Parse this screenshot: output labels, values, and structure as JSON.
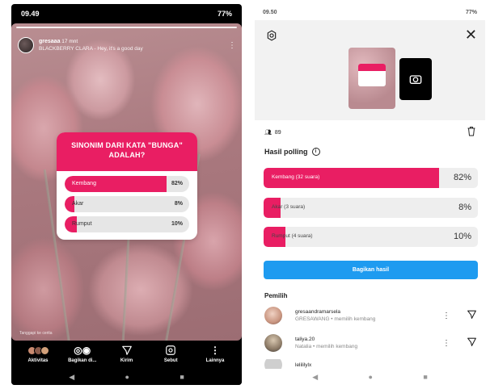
{
  "left": {
    "status": {
      "time": "09.49",
      "battery": "77%"
    },
    "story": {
      "username": "gresaaa",
      "time_ago": "17 mnt",
      "music": "BLACKBERRY CLARA - Hey, it's a good day",
      "footnote": "Tanggapi ke cerita"
    },
    "poll": {
      "question": "SINONIM DARI KATA \"BUNGA\" ADALAH?",
      "options": [
        {
          "label": "Kembang",
          "percent": "82%",
          "value": 82
        },
        {
          "label": "Akar",
          "percent": "8%",
          "value": 8
        },
        {
          "label": "Rumput",
          "percent": "10%",
          "value": 10
        }
      ]
    },
    "bottom_bar": [
      {
        "label": "Aktivitas",
        "icon": "avatars-icon"
      },
      {
        "label": "Bagikan di...",
        "icon": "share-apps-icon"
      },
      {
        "label": "Kirim",
        "icon": "send-icon"
      },
      {
        "label": "Sebut",
        "icon": "mention-icon"
      },
      {
        "label": "Lainnya",
        "icon": "more-icon"
      }
    ],
    "nav": {
      "back": "◀",
      "home": "●",
      "recent": "■"
    }
  },
  "right": {
    "status": {
      "time": "09.50",
      "battery": "77%"
    },
    "viewers_count": "89",
    "section_title": "Hasil polling",
    "results": [
      {
        "label": "Kembang (32 suara)",
        "percent": "82%",
        "value": 82
      },
      {
        "label": "Akar (3 suara)",
        "percent": "8%",
        "value": 8
      },
      {
        "label": "Rumput (4 suara)",
        "percent": "10%",
        "value": 10
      }
    ],
    "share_button": "Bagikan hasil",
    "voters_title": "Pemilih",
    "voters": [
      {
        "name": "gresaandramarsela",
        "detail": "GRESAWANG • memilih kembang"
      },
      {
        "name": "taliya.20",
        "detail": "Natalia • memilih kembang"
      },
      {
        "name": "lelililylx",
        "detail": ""
      }
    ],
    "nav": {
      "back": "◀",
      "home": "●",
      "recent": "■"
    }
  }
}
